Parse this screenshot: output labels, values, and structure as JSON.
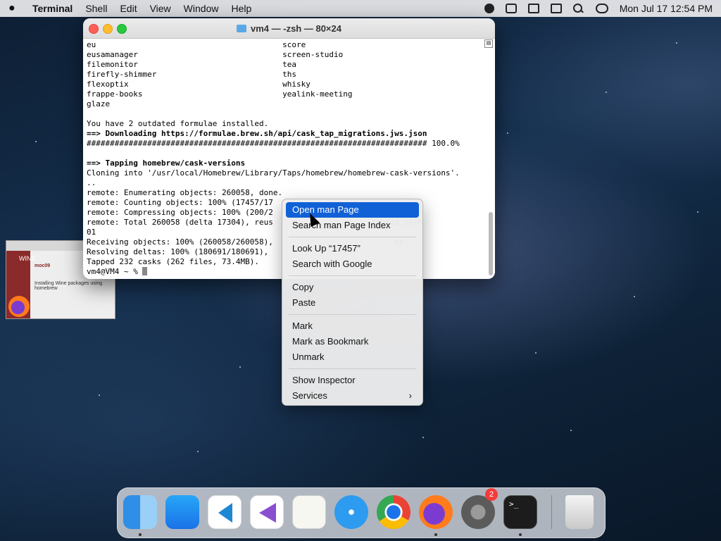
{
  "menubar": {
    "app": "Terminal",
    "items": [
      "Shell",
      "Edit",
      "View",
      "Window",
      "Help"
    ],
    "clock": "Mon Jul 17  12:54 PM"
  },
  "terminal": {
    "title": "vm4 — -zsh — 80×24",
    "lines": [
      "eu                                        score",
      "eusamanager                               screen-studio",
      "filemonitor                               tea",
      "firefly-shimmer                           ths",
      "flexoptix                                 whisky",
      "frappe-books                              yealink-meeting",
      "glaze",
      "",
      "You have 2 outdated formulae installed.",
      "==> Downloading https://formulae.brew.sh/api/cask_tap_migrations.jws.json",
      "######################################################################### 100.0%",
      "",
      "==> Tapping homebrew/cask-versions",
      "Cloning into '/usr/local/Homebrew/Library/Taps/homebrew/homebrew-cask-versions'.",
      "..",
      "remote: Enumerating objects: 260058, done.",
      "remote: Counting objects: 100% (17457/17",
      "remote: Compressing objects: 100% (200/2                            ",
      "remote: Total 260058 (delta 17304), reus                    -reused 2426",
      "01",
      "Receiving objects: 100% (260058/260058),                          ne.",
      "Resolving deltas: 100% (180691/180691),",
      "Tapped 232 casks (262 files, 73.4MB).",
      "vm4@VM4 ~ % "
    ]
  },
  "thumbnail": {
    "site": "WINE",
    "user": "moc09",
    "heading": "Installing Wine packages using homebrew"
  },
  "context_menu": {
    "groups": [
      [
        "Open man Page",
        "Search man Page Index"
      ],
      [
        "Look Up “17457”",
        "Search with Google"
      ],
      [
        "Copy",
        "Paste"
      ],
      [
        "Mark",
        "Mark as Bookmark",
        "Unmark"
      ],
      [
        "Show Inspector",
        "Services"
      ]
    ]
  },
  "dock": {
    "apps": [
      "Finder",
      "App Store",
      "Visual Studio Code",
      "Visual Studio",
      "TextEdit",
      "Safari",
      "Google Chrome",
      "Firefox",
      "System Settings",
      "Terminal",
      "Trash"
    ],
    "settings_badge": "2"
  }
}
